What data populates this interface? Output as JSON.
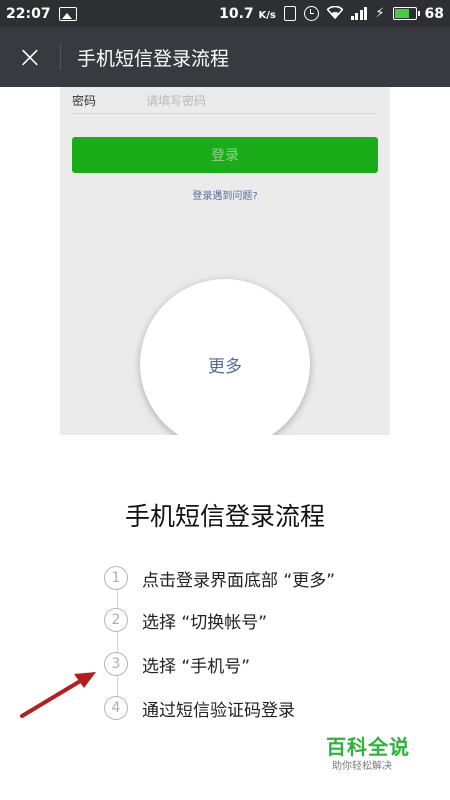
{
  "status_bar": {
    "time": "22:07",
    "speed": "10.7",
    "speed_unit": "K/s",
    "battery": "68"
  },
  "title_bar": {
    "close_icon": "×",
    "title": "手机短信登录流程"
  },
  "screenshot_card": {
    "password_label": "密码",
    "password_placeholder": "请填写密码",
    "login_button": "登录",
    "help_link": "登录遇到问题?",
    "more_label": "更多"
  },
  "heading": "手机短信登录流程",
  "steps": [
    {
      "num": "1",
      "text": "点击登录界面底部 “更多”"
    },
    {
      "num": "2",
      "text": "选择 “切换帐号”"
    },
    {
      "num": "3",
      "text": "选择 “手机号”"
    },
    {
      "num": "4",
      "text": "通过短信验证码登录"
    }
  ],
  "watermark": {
    "brand": "百科全说",
    "slogan": "助你轻松解决"
  },
  "colors": {
    "title_bar": "#393a3f",
    "login_green": "#1aad19",
    "arrow": "#b21f1f",
    "brand_green": "#2fb13c"
  }
}
